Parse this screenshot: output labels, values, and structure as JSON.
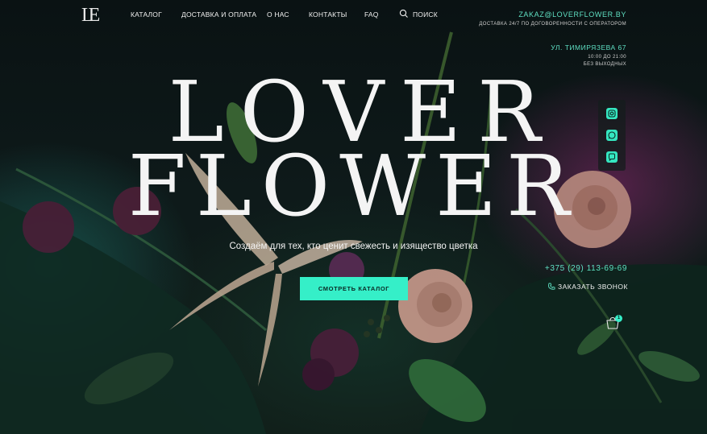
{
  "header": {
    "logo_text": "LE",
    "nav": [
      {
        "label": "Каталог"
      },
      {
        "label": "Доставка и оплата"
      },
      {
        "label": "О нас"
      },
      {
        "label": "Контакты"
      },
      {
        "label": "FAQ"
      },
      {
        "label": "Поиск"
      }
    ]
  },
  "contact": {
    "email": "ZAKAZ@LOVERFLOWER.BY",
    "email_note": "Доставка 24/7 по договоренности с оператором",
    "address": "ул. Тимирязева 67",
    "hours": "10:00 до 21:00",
    "days": "без выходных"
  },
  "hero": {
    "line1": "LOVER",
    "line2": "FLOWER",
    "tagline": "Создаём для тех, кто ценит свежесть и изящество цветка",
    "cta_label": "Смотреть каталог"
  },
  "socials": [
    "instagram-icon",
    "whatsapp-icon",
    "viber-icon"
  ],
  "side": {
    "phone": "+375 (29) 113-69-69",
    "callback_label": "Заказать звонок",
    "cart_count": "1"
  },
  "colors": {
    "accent": "#35efc8",
    "background": "#0b1414",
    "text": "#f4f4f4"
  }
}
